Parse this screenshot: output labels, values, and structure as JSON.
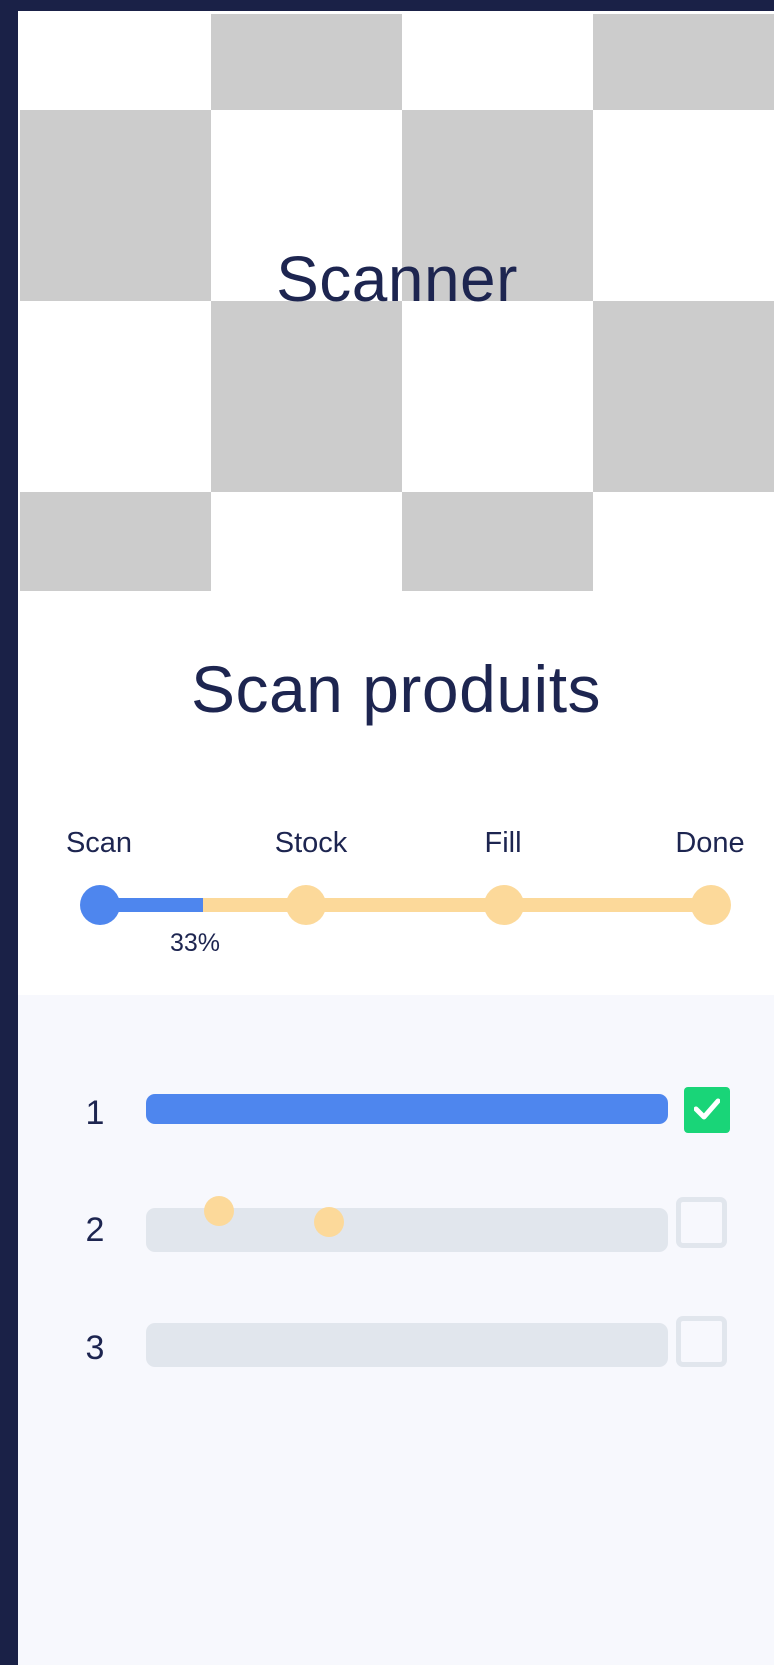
{
  "hero": {
    "title": "Scanner"
  },
  "page_title": "Scan produits",
  "stepper": {
    "steps": [
      {
        "label": "Scan",
        "state": "active"
      },
      {
        "label": "Stock",
        "state": "pending"
      },
      {
        "label": "Fill",
        "state": "pending"
      },
      {
        "label": "Done",
        "state": "pending"
      }
    ],
    "progress_text": "33%"
  },
  "rows": [
    {
      "number": "1",
      "checked": true
    },
    {
      "number": "2",
      "checked": false
    },
    {
      "number": "3",
      "checked": false
    }
  ],
  "colors": {
    "primary": "#4e86ee",
    "pending": "#fcd99a",
    "success": "#19d578",
    "text": "#1d2550",
    "frame": "#1a2147"
  },
  "icons": {
    "check": "check-icon"
  }
}
